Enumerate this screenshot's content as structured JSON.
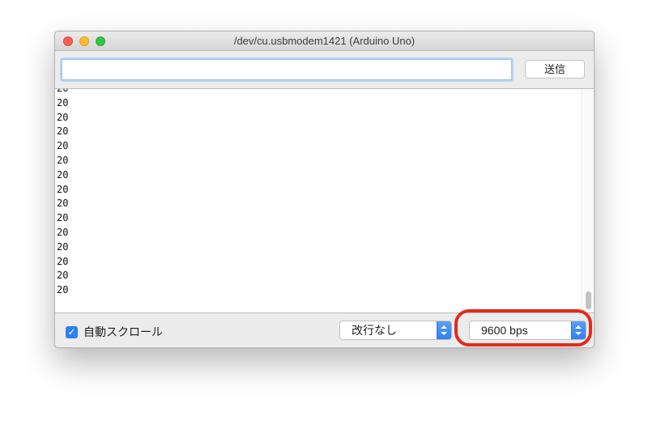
{
  "window": {
    "title": "/dev/cu.usbmodem1421 (Arduino Uno)"
  },
  "input_bar": {
    "value": "",
    "placeholder": "",
    "send_label": "送信"
  },
  "serial_output": {
    "lines": [
      "20",
      "20",
      "20",
      "20",
      "20",
      "20",
      "20",
      "20",
      "20",
      "20",
      "20",
      "20",
      "20",
      "20",
      "20"
    ]
  },
  "bottom_bar": {
    "autoscroll_label": "自動スクロール",
    "autoscroll_checked": true,
    "checkmark_glyph": "✓",
    "line_ending": "改行なし",
    "baud_rate": "9600 bps"
  },
  "colors": {
    "accent": "#2d7ff5",
    "highlight_ring": "#e32a1d"
  },
  "icons": {
    "checkbox": "checkmark-icon",
    "select_arrows": "up-down-chevron-icon"
  }
}
